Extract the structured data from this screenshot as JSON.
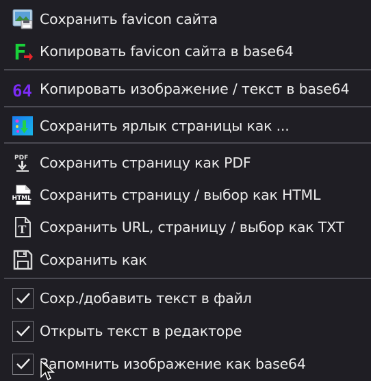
{
  "menu": {
    "items": [
      {
        "label": "Сохранить favicon сайта",
        "icon": "save-image-icon"
      },
      {
        "label": "Копировать favicon сайта в base64",
        "icon": "favicon-letter-icon"
      },
      {
        "label": "Копировать изображение / текст в base64",
        "icon": "base64-icon"
      },
      {
        "label": "Сохранить ярлык страницы как ...",
        "icon": "shortcut-icon"
      },
      {
        "label": "Сохранить страницу как PDF",
        "icon": "pdf-icon"
      },
      {
        "label": "Сохранить страницу / выбор как HTML",
        "icon": "html-icon"
      },
      {
        "label": "Сохранить URL, страницу / выбор как TXT",
        "icon": "txt-icon"
      },
      {
        "label": "Сохранить как",
        "icon": "floppy-disk-icon"
      }
    ],
    "checks": [
      {
        "label": "Сохр./добавить текст в файл",
        "checked": true
      },
      {
        "label": "Открыть текст в редакторе",
        "checked": true
      },
      {
        "label": "Запомнить изображение как base64",
        "checked": true
      }
    ],
    "icon_text": {
      "pdf": "PDF",
      "html": "HTML",
      "txt": "T",
      "b64": "64",
      "fav": "F"
    }
  },
  "colors": {
    "background": "#1f1e24",
    "text": "#ececec",
    "separator": "#4a4a52",
    "base64_purple": "#7b2cf5",
    "favicon_green": "#19d13a",
    "favicon_red": "#e8262b"
  }
}
